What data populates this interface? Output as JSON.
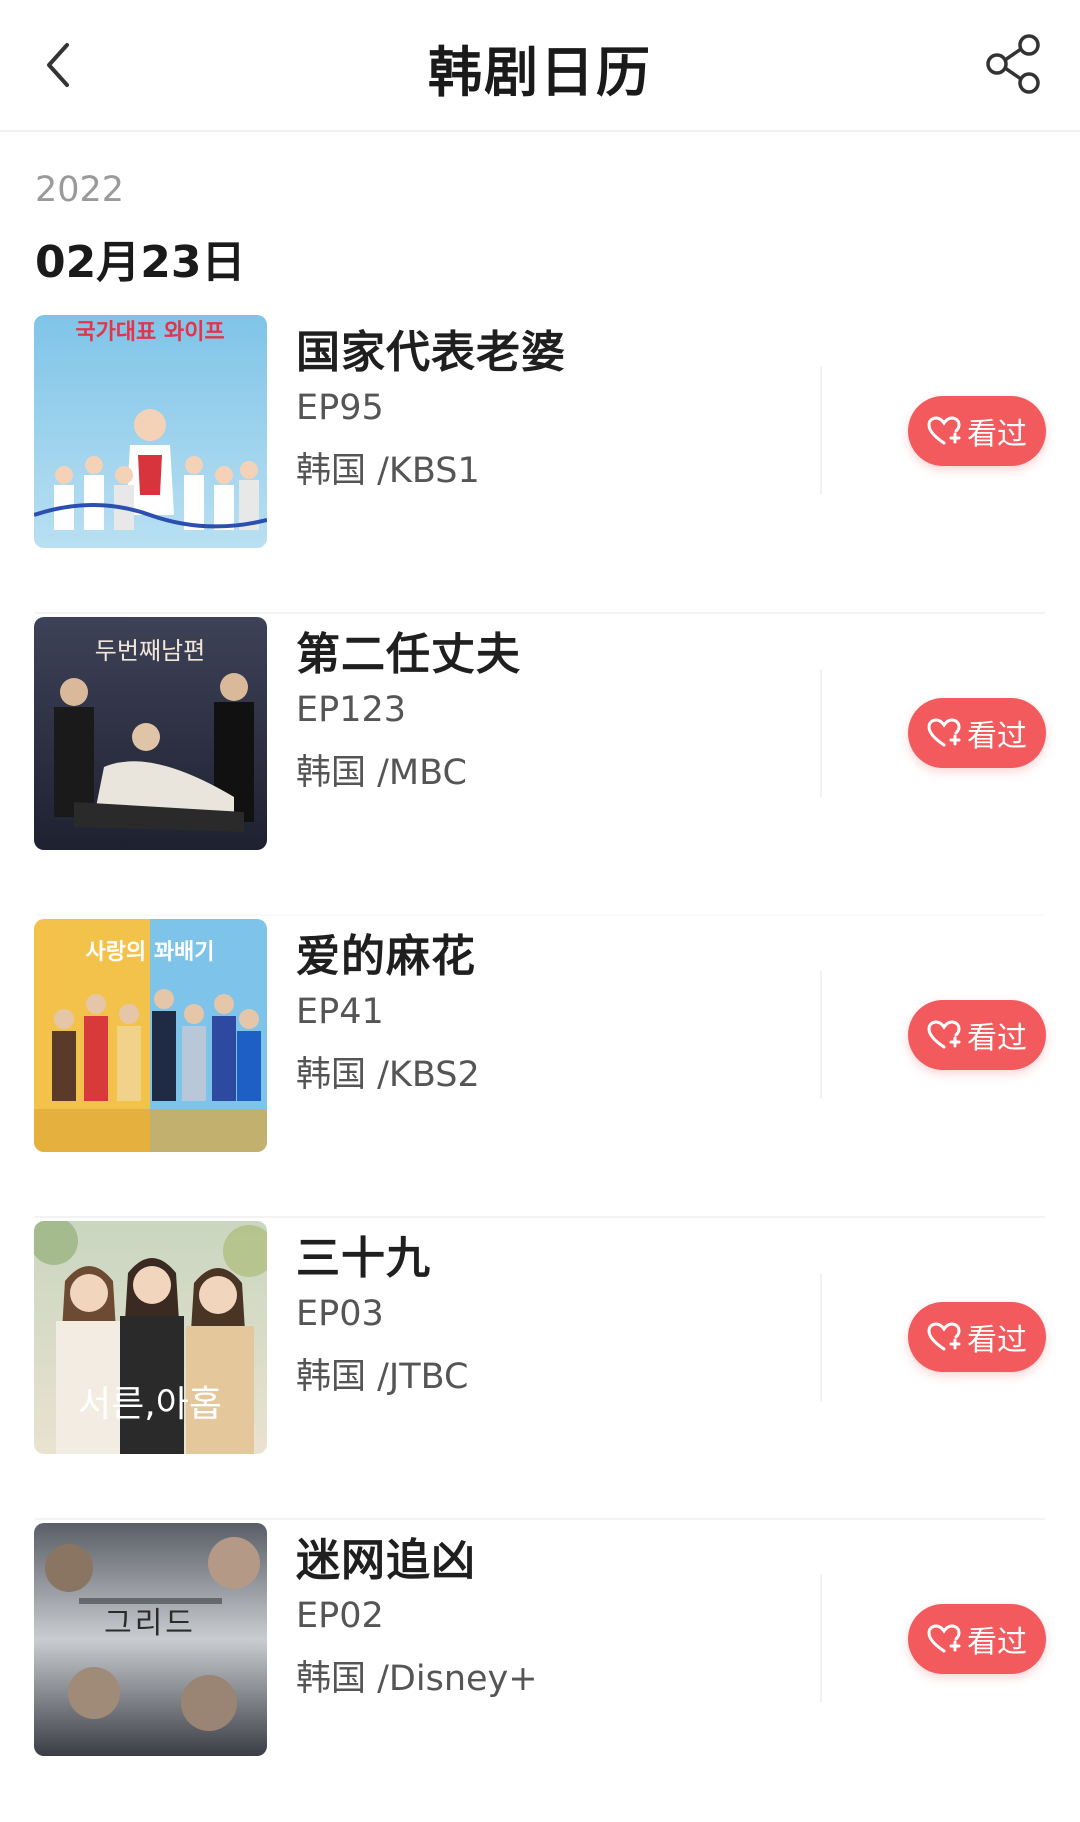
{
  "header": {
    "title": "韩剧日历"
  },
  "date": {
    "year": "2022",
    "day": "02月23日"
  },
  "shows": [
    {
      "title": "国家代表老婆",
      "episode": "EP95",
      "network": "韩国 /KBS1",
      "button_label": "看过"
    },
    {
      "title": "第二任丈夫",
      "episode": "EP123",
      "network": "韩国 /MBC",
      "button_label": "看过"
    },
    {
      "title": "爱的麻花",
      "episode": "EP41",
      "network": "韩国 /KBS2",
      "button_label": "看过"
    },
    {
      "title": "三十九",
      "episode": "EP03",
      "network": "韩国 /JTBC",
      "button_label": "看过"
    },
    {
      "title": "迷网追凶",
      "episode": "EP02",
      "network": "韩国 /Disney+",
      "button_label": "看过"
    }
  ],
  "posters": [
    {
      "text": "국가대표 와이프"
    },
    {
      "text": "두번째남편"
    },
    {
      "text": "사랑의 꽈배기"
    },
    {
      "text": "서른,아홉"
    },
    {
      "text": "그리드"
    }
  ],
  "colors": {
    "accent": "#f25a5e",
    "title_text": "#1a1a1a",
    "secondary_text": "#555555",
    "year_text": "#9a9a9a"
  },
  "icons": {
    "back": "chevron-left-icon",
    "share": "share-icon",
    "watched": "heart-plus-icon"
  }
}
